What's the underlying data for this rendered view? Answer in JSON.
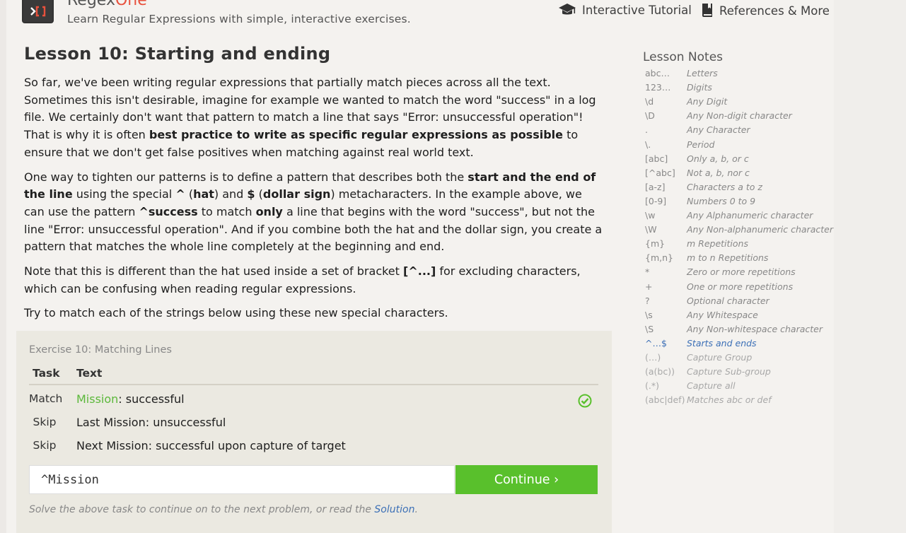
{
  "header": {
    "brand_main": "Regex",
    "brand_accent": "One",
    "tagline": "Learn Regular Expressions with simple, interactive exercises.",
    "nav": [
      {
        "label": "Interactive Tutorial",
        "icon": "graduation-cap-icon"
      },
      {
        "label": "References & More",
        "icon": "book-icon"
      }
    ]
  },
  "lesson": {
    "title": "Lesson 10: Starting and ending",
    "p1": {
      "a": "So far, we've been writing regular expressions that partially match pieces across all the text. Sometimes this isn't desirable, imagine for example we wanted to match the word \"success\" in a log file. We certainly don't want that pattern to match a line that says \"Error: unsuccessful operation\"! That is why it is often ",
      "b": "best practice to write as specific regular expressions as possible",
      "c": " to ensure that we don't get false positives when matching against real world text."
    },
    "p2": {
      "a": "One way to tighten our patterns is to define a pattern that describes both the ",
      "b": "start and the end of the line",
      "c": " using the special ",
      "d": "^",
      "e": " (",
      "f": "hat",
      "g": ") and ",
      "h": "$",
      "i": " (",
      "j": "dollar sign",
      "k": ") metacharacters. In the example above, we can use the pattern ",
      "l": "^success",
      "m": " to match ",
      "n": "only",
      "o": " a line that begins with the word \"success\", but not the line \"Error: unsuccessful operation\". And if you combine both the hat and the dollar sign, you create a pattern that matches the whole line completely at the beginning and end."
    },
    "p3": {
      "a": "Note that this is different than the hat used inside a set of bracket ",
      "b": "[^...]",
      "c": " for excluding characters, which can be confusing when reading regular expressions."
    },
    "p4": "Try to match each of the strings below using these new special characters."
  },
  "exercise": {
    "title": "Exercise 10: Matching Lines",
    "col_task": "Task",
    "col_text": "Text",
    "rows": [
      {
        "task": "Match",
        "highlight": "Mission",
        "rest": ": successful",
        "status": "check-circle-icon"
      },
      {
        "task": "Skip",
        "highlight": "",
        "rest": "Last Mission: unsuccessful"
      },
      {
        "task": "Skip",
        "highlight": "",
        "rest": "Next Mission: successful upon capture of target"
      }
    ],
    "input_value": "^Mission",
    "continue_label": "Continue ›",
    "footer_text": "Solve the above task to continue on to the next problem, or read the ",
    "footer_link": "Solution",
    "footer_end": "."
  },
  "notes": {
    "title": "Lesson Notes",
    "items": [
      {
        "k": "abc…",
        "d": "Letters"
      },
      {
        "k": "123…",
        "d": "Digits"
      },
      {
        "k": "\\d",
        "d": "Any Digit"
      },
      {
        "k": "\\D",
        "d": "Any Non-digit character"
      },
      {
        "k": ".",
        "d": "Any Character"
      },
      {
        "k": "\\.",
        "d": "Period"
      },
      {
        "k": "[abc]",
        "d": "Only a, b, or c"
      },
      {
        "k": "[^abc]",
        "d": "Not a, b, nor c"
      },
      {
        "k": "[a-z]",
        "d": "Characters a to z"
      },
      {
        "k": "[0-9]",
        "d": "Numbers 0 to 9"
      },
      {
        "k": "\\w",
        "d": "Any Alphanumeric character"
      },
      {
        "k": "\\W",
        "d": "Any Non-alphanumeric character"
      },
      {
        "k": "{m}",
        "d": "m Repetitions"
      },
      {
        "k": "{m,n}",
        "d": "m to n Repetitions"
      },
      {
        "k": "*",
        "d": "Zero or more repetitions"
      },
      {
        "k": "+",
        "d": "One or more repetitions"
      },
      {
        "k": "?",
        "d": "Optional character"
      },
      {
        "k": "\\s",
        "d": "Any Whitespace"
      },
      {
        "k": "\\S",
        "d": "Any Non-whitespace character"
      },
      {
        "k": "^…$",
        "d": "Starts and ends"
      },
      {
        "k": "(…)",
        "d": "Capture Group"
      },
      {
        "k": "(a(bc))",
        "d": "Capture Sub-group"
      },
      {
        "k": "(.*)",
        "d": "Capture all"
      },
      {
        "k": "(abc|def)",
        "d": "Matches abc or def"
      }
    ],
    "current_index": 19
  },
  "colors": {
    "accent_green": "#59c02c",
    "brand_red": "#e8513d",
    "link_blue": "#3b6fb6"
  }
}
